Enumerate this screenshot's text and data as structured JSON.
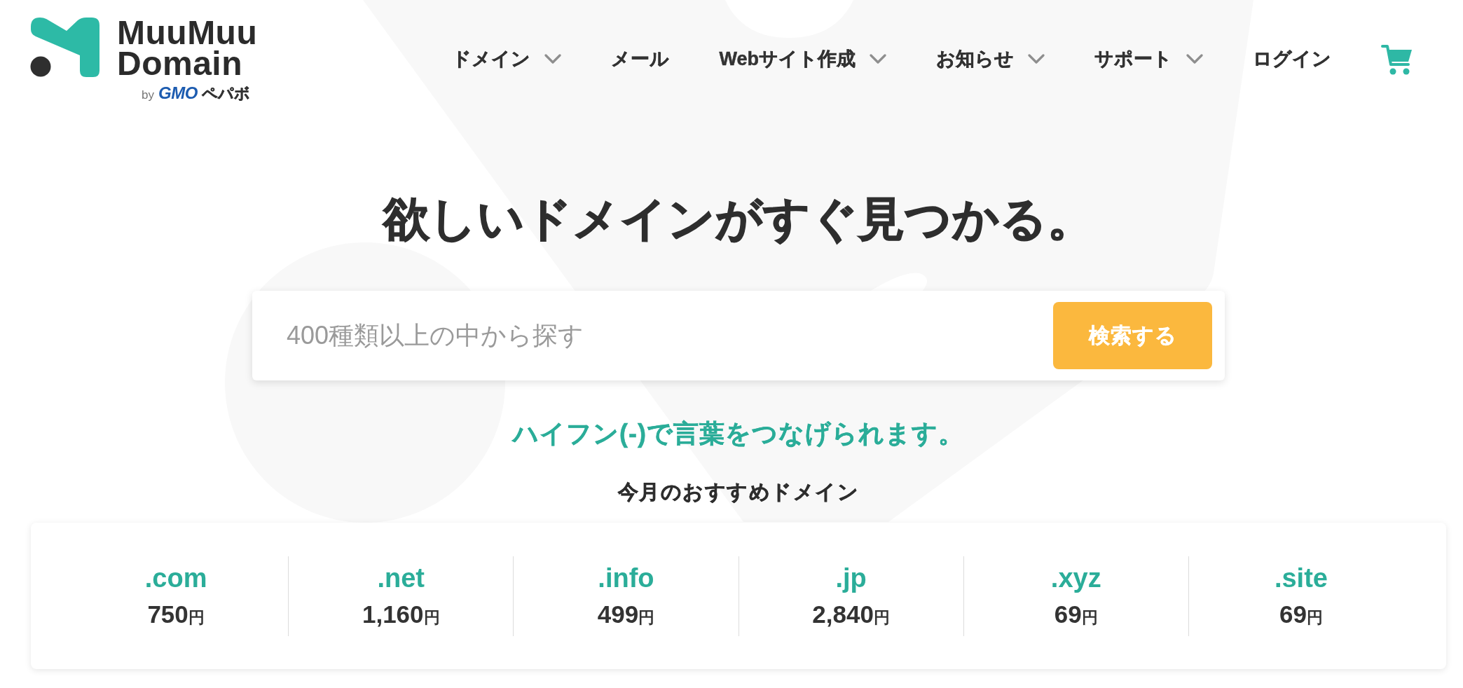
{
  "logo": {
    "wordmark": [
      "MuuMuu",
      "Domain"
    ],
    "byline": [
      {
        "kind": "prefix",
        "text": "by"
      },
      {
        "kind": "latin",
        "text": "GMO"
      },
      {
        "kind": "kana",
        "text": "ペパボ"
      }
    ]
  },
  "nav": {
    "items": [
      {
        "label": "ドメイン",
        "dropdown": true
      },
      {
        "label": "メール",
        "dropdown": false
      },
      {
        "label": "Webサイト作成",
        "dropdown": true
      },
      {
        "label": "お知らせ",
        "dropdown": true
      },
      {
        "label": "サポート",
        "dropdown": true
      },
      {
        "label": "ログイン",
        "dropdown": false
      }
    ]
  },
  "hero": {
    "title": "欲しいドメインがすぐ見つかる。",
    "search": {
      "placeholder": "400種類以上の中から探す",
      "button": "検索する"
    },
    "hint": "ハイフン(-)で言葉をつなげられます。"
  },
  "featured": {
    "title": "今月のおすすめドメイン",
    "domains": [
      {
        "tld": ".com",
        "price": "750",
        "unit": "円"
      },
      {
        "tld": ".net",
        "price": "1,160",
        "unit": "円"
      },
      {
        "tld": ".info",
        "price": "499",
        "unit": "円"
      },
      {
        "tld": ".jp",
        "price": "2,840",
        "unit": "円"
      },
      {
        "tld": ".xyz",
        "price": "69",
        "unit": "円"
      },
      {
        "tld": ".site",
        "price": "69",
        "unit": "円"
      }
    ]
  }
}
